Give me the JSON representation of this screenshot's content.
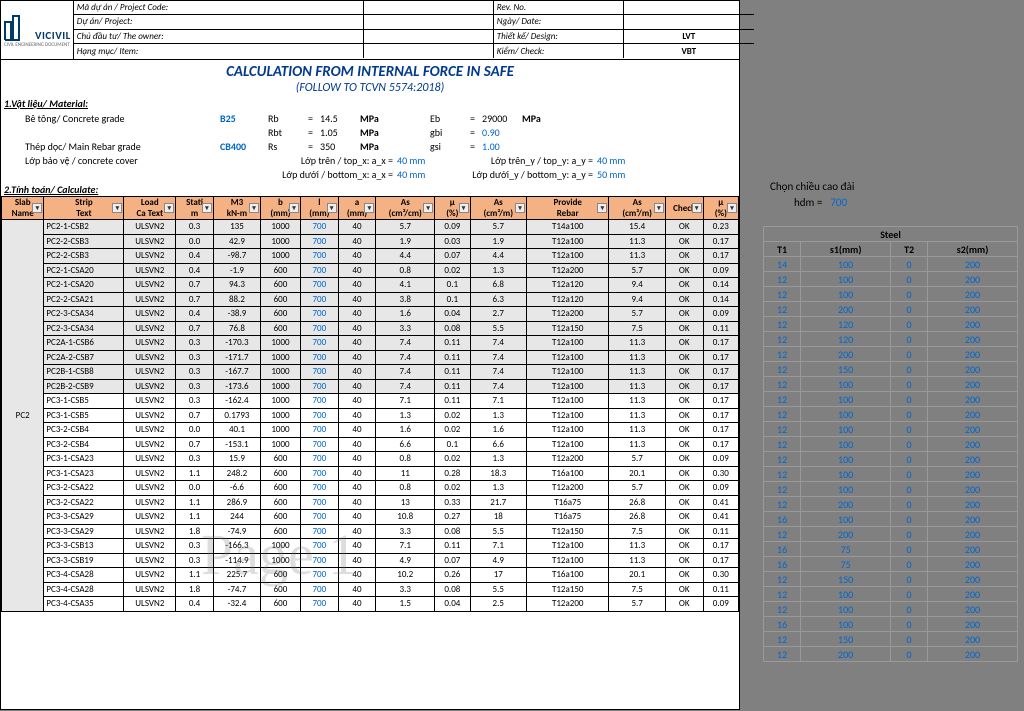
{
  "header": {
    "project_code_lbl": "Mã dự án / Project Code:",
    "project_lbl": "Dự án/ Project:",
    "owner_lbl": "Chủ đầu tư/ The owner:",
    "item_lbl": "Hạng mục/ Item:",
    "rev_lbl": "Rev. No.",
    "date_lbl": "Ngày/ Date:",
    "design_lbl": "Thiết kế/ Design:",
    "design_val": "LVT",
    "check_lbl": "Kiểm/ Check:",
    "check_val": "VBT"
  },
  "logo_text": "VICIVIL",
  "logo_sub": "CIVIL ENGINEERING DOCUMENT",
  "title1": "CALCULATION FROM INTERNAL FORCE IN SAFE",
  "title2": "(FOLLOW TO TCVN 5574:2018)",
  "sec1": "1.Vật liệu/ Material:",
  "sec2": "2.Tính toán/ Calculate:",
  "material": {
    "concrete_lbl": "Bê tông/ Concrete grade",
    "concrete_val": "B25",
    "Rb_sym": "Rb",
    "Rb_eq": "=",
    "Rb_num": "14.5",
    "Rb_unit": "MPa",
    "Rbt_sym": "Rbt",
    "Rbt_eq": "=",
    "Rbt_num": "1.05",
    "Rbt_unit": "MPa",
    "Eb_sym": "Eb",
    "Eb_eq": "=",
    "Eb_num": "29000",
    "Eb_unit": "MPa",
    "gbi_sym": "gbi",
    "gbi_eq": "=",
    "gbi_num": "0.90",
    "rebar_lbl": "Thép dọc/ Main Rebar grade",
    "rebar_val": "CB400",
    "Rs_sym": "Rs",
    "Rs_eq": "=",
    "Rs_num": "350",
    "Rs_unit": "MPa",
    "gsi_sym": "gsi",
    "gsi_eq": "=",
    "gsi_num": "1.00",
    "cover_lbl": "Lớp bảo vệ / concrete cover",
    "topx_lbl": "Lớp trên / top_x:  a_x =",
    "topx_val": "40 mm",
    "botx_lbl": "Lớp dưới / bottom_x:  a_x =",
    "botx_val": "40 mm",
    "topy_lbl": "Lớp trên_y / top_y:  a_y =",
    "topy_val": "40 mm",
    "boty_lbl": "Lớp dưới_y / bottom_y:  a_y =",
    "boty_val": "50 mm"
  },
  "side": {
    "label": "Chọn chiều cao đài",
    "hdm_lbl": "hdm =",
    "hdm_val": "700"
  },
  "cols": [
    "Slab Name",
    "Strip Text",
    "Load Ca Text",
    "Stati m",
    "M3 kN-m",
    "b (mm)",
    "l (mm)",
    "a (mm)",
    "As (cm²/cm)",
    "μ (%)",
    "As (cm²/m)",
    "Provide Rebar",
    "As (cm²/m)",
    "Check",
    "μ (%)"
  ],
  "steel_hdr": "Steel",
  "steel_cols": [
    "T1",
    "s1(mm)",
    "T2",
    "s2(mm)"
  ],
  "rows": [
    {
      "slab": "PC2",
      "strip": "PC2-1-CSB2",
      "lc": "ULSVN2",
      "st": "0.3",
      "m3": "135",
      "b": "1000",
      "l": "700",
      "a": "40",
      "asc": "5.7",
      "mu": "0.09",
      "asm": "5.7",
      "rebar": "T14a100",
      "asp": "15.4",
      "chk": "OK",
      "mu2": "0.23",
      "t1": "14",
      "s1": "100",
      "t2": "0",
      "s2": "200",
      "band": 1
    },
    {
      "slab": "",
      "strip": "PC2-2-CSB3",
      "lc": "ULSVN2",
      "st": "0.0",
      "m3": "42.9",
      "b": "1000",
      "l": "700",
      "a": "40",
      "asc": "1.9",
      "mu": "0.03",
      "asm": "1.9",
      "rebar": "T12a100",
      "asp": "11.3",
      "chk": "OK",
      "mu2": "0.17",
      "t1": "12",
      "s1": "100",
      "t2": "0",
      "s2": "200",
      "band": 1
    },
    {
      "slab": "",
      "strip": "PC2-2-CSB3",
      "lc": "ULSVN2",
      "st": "0.4",
      "m3": "-98.7",
      "b": "1000",
      "l": "700",
      "a": "40",
      "asc": "4.4",
      "mu": "0.07",
      "asm": "4.4",
      "rebar": "T12a100",
      "asp": "11.3",
      "chk": "OK",
      "mu2": "0.17",
      "t1": "12",
      "s1": "100",
      "t2": "0",
      "s2": "200",
      "band": 1
    },
    {
      "slab": "",
      "strip": "PC2-1-CSA20",
      "lc": "ULSVN2",
      "st": "0.4",
      "m3": "-1.9",
      "b": "600",
      "l": "700",
      "a": "40",
      "asc": "0.8",
      "mu": "0.02",
      "asm": "1.3",
      "rebar": "T12a200",
      "asp": "5.7",
      "chk": "OK",
      "mu2": "0.09",
      "t1": "12",
      "s1": "200",
      "t2": "0",
      "s2": "200",
      "band": 1
    },
    {
      "slab": "",
      "strip": "PC2-1-CSA20",
      "lc": "ULSVN2",
      "st": "0.7",
      "m3": "94.3",
      "b": "600",
      "l": "700",
      "a": "40",
      "asc": "4.1",
      "mu": "0.1",
      "asm": "6.8",
      "rebar": "T12a120",
      "asp": "9.4",
      "chk": "OK",
      "mu2": "0.14",
      "t1": "12",
      "s1": "120",
      "t2": "0",
      "s2": "200",
      "band": 1
    },
    {
      "slab": "",
      "strip": "PC2-2-CSA21",
      "lc": "ULSVN2",
      "st": "0.7",
      "m3": "88.2",
      "b": "600",
      "l": "700",
      "a": "40",
      "asc": "3.8",
      "mu": "0.1",
      "asm": "6.3",
      "rebar": "T12a120",
      "asp": "9.4",
      "chk": "OK",
      "mu2": "0.14",
      "t1": "12",
      "s1": "120",
      "t2": "0",
      "s2": "200",
      "band": 1
    },
    {
      "slab": "",
      "strip": "PC2-3-CSA34",
      "lc": "ULSVN2",
      "st": "0.4",
      "m3": "-38.9",
      "b": "600",
      "l": "700",
      "a": "40",
      "asc": "1.6",
      "mu": "0.04",
      "asm": "2.7",
      "rebar": "T12a200",
      "asp": "5.7",
      "chk": "OK",
      "mu2": "0.09",
      "t1": "12",
      "s1": "200",
      "t2": "0",
      "s2": "200",
      "band": 1
    },
    {
      "slab": "",
      "strip": "PC2-3-CSA34",
      "lc": "ULSVN2",
      "st": "0.7",
      "m3": "76.8",
      "b": "600",
      "l": "700",
      "a": "40",
      "asc": "3.3",
      "mu": "0.08",
      "asm": "5.5",
      "rebar": "T12a150",
      "asp": "7.5",
      "chk": "OK",
      "mu2": "0.11",
      "t1": "12",
      "s1": "150",
      "t2": "0",
      "s2": "200",
      "band": 1
    },
    {
      "slab": "",
      "strip": "PC2A-1-CSB6",
      "lc": "ULSVN2",
      "st": "0.3",
      "m3": "-170.3",
      "b": "1000",
      "l": "700",
      "a": "40",
      "asc": "7.4",
      "mu": "0.11",
      "asm": "7.4",
      "rebar": "T12a100",
      "asp": "11.3",
      "chk": "OK",
      "mu2": "0.17",
      "t1": "12",
      "s1": "100",
      "t2": "0",
      "s2": "200",
      "band": 1
    },
    {
      "slab": "",
      "strip": "PC2A-2-CSB7",
      "lc": "ULSVN2",
      "st": "0.3",
      "m3": "-171.7",
      "b": "1000",
      "l": "700",
      "a": "40",
      "asc": "7.4",
      "mu": "0.11",
      "asm": "7.4",
      "rebar": "T12a100",
      "asp": "11.3",
      "chk": "OK",
      "mu2": "0.17",
      "t1": "12",
      "s1": "100",
      "t2": "0",
      "s2": "200",
      "band": 1
    },
    {
      "slab": "",
      "strip": "PC2B-1-CSB8",
      "lc": "ULSVN2",
      "st": "0.3",
      "m3": "-167.7",
      "b": "1000",
      "l": "700",
      "a": "40",
      "asc": "7.4",
      "mu": "0.11",
      "asm": "7.4",
      "rebar": "T12a100",
      "asp": "11.3",
      "chk": "OK",
      "mu2": "0.17",
      "t1": "12",
      "s1": "100",
      "t2": "0",
      "s2": "200",
      "band": 1
    },
    {
      "slab": "",
      "strip": "PC2B-2-CSB9",
      "lc": "ULSVN2",
      "st": "0.3",
      "m3": "-173.6",
      "b": "1000",
      "l": "700",
      "a": "40",
      "asc": "7.4",
      "mu": "0.11",
      "asm": "7.4",
      "rebar": "T12a100",
      "asp": "11.3",
      "chk": "OK",
      "mu2": "0.17",
      "t1": "12",
      "s1": "100",
      "t2": "0",
      "s2": "200",
      "band": 1
    },
    {
      "slab": "",
      "strip": "PC3-1-CSB5",
      "lc": "ULSVN2",
      "st": "0.3",
      "m3": "-162.4",
      "b": "1000",
      "l": "700",
      "a": "40",
      "asc": "7.1",
      "mu": "0.11",
      "asm": "7.1",
      "rebar": "T12a100",
      "asp": "11.3",
      "chk": "OK",
      "mu2": "0.17",
      "t1": "12",
      "s1": "100",
      "t2": "0",
      "s2": "200",
      "band": 0
    },
    {
      "slab": "",
      "strip": "PC3-1-CSB5",
      "lc": "ULSVN2",
      "st": "0.7",
      "m3": "0.1793",
      "b": "1000",
      "l": "700",
      "a": "40",
      "asc": "1.3",
      "mu": "0.02",
      "asm": "1.3",
      "rebar": "T12a100",
      "asp": "11.3",
      "chk": "OK",
      "mu2": "0.17",
      "t1": "12",
      "s1": "100",
      "t2": "0",
      "s2": "200",
      "band": 0
    },
    {
      "slab": "",
      "strip": "PC3-2-CSB4",
      "lc": "ULSVN2",
      "st": "0.0",
      "m3": "40.1",
      "b": "1000",
      "l": "700",
      "a": "40",
      "asc": "1.6",
      "mu": "0.02",
      "asm": "1.6",
      "rebar": "T12a100",
      "asp": "11.3",
      "chk": "OK",
      "mu2": "0.17",
      "t1": "12",
      "s1": "100",
      "t2": "0",
      "s2": "200",
      "band": 0
    },
    {
      "slab": "",
      "strip": "PC3-2-CSB4",
      "lc": "ULSVN2",
      "st": "0.7",
      "m3": "-153.1",
      "b": "1000",
      "l": "700",
      "a": "40",
      "asc": "6.6",
      "mu": "0.1",
      "asm": "6.6",
      "rebar": "T12a100",
      "asp": "11.3",
      "chk": "OK",
      "mu2": "0.17",
      "t1": "12",
      "s1": "100",
      "t2": "0",
      "s2": "200",
      "band": 0
    },
    {
      "slab": "",
      "strip": "PC3-1-CSA23",
      "lc": "ULSVN2",
      "st": "0.3",
      "m3": "15.9",
      "b": "600",
      "l": "700",
      "a": "40",
      "asc": "0.8",
      "mu": "0.02",
      "asm": "1.3",
      "rebar": "T12a200",
      "asp": "5.7",
      "chk": "OK",
      "mu2": "0.09",
      "t1": "12",
      "s1": "200",
      "t2": "0",
      "s2": "200",
      "band": 0
    },
    {
      "slab": "",
      "strip": "PC3-1-CSA23",
      "lc": "ULSVN2",
      "st": "1.1",
      "m3": "248.2",
      "b": "600",
      "l": "700",
      "a": "40",
      "asc": "11",
      "mu": "0.28",
      "asm": "18.3",
      "rebar": "T16a100",
      "asp": "20.1",
      "chk": "OK",
      "mu2": "0.30",
      "t1": "16",
      "s1": "100",
      "t2": "0",
      "s2": "200",
      "band": 0
    },
    {
      "slab": "",
      "strip": "PC3-2-CSA22",
      "lc": "ULSVN2",
      "st": "0.0",
      "m3": "-6.6",
      "b": "600",
      "l": "700",
      "a": "40",
      "asc": "0.8",
      "mu": "0.02",
      "asm": "1.3",
      "rebar": "T12a200",
      "asp": "5.7",
      "chk": "OK",
      "mu2": "0.09",
      "t1": "12",
      "s1": "200",
      "t2": "0",
      "s2": "200",
      "band": 0
    },
    {
      "slab": "",
      "strip": "PC3-2-CSA22",
      "lc": "ULSVN2",
      "st": "1.1",
      "m3": "286.9",
      "b": "600",
      "l": "700",
      "a": "40",
      "asc": "13",
      "mu": "0.33",
      "asm": "21.7",
      "rebar": "T16a75",
      "asp": "26.8",
      "chk": "OK",
      "mu2": "0.41",
      "t1": "16",
      "s1": "75",
      "t2": "0",
      "s2": "200",
      "band": 0
    },
    {
      "slab": "",
      "strip": "PC3-3-CSA29",
      "lc": "ULSVN2",
      "st": "1.1",
      "m3": "244",
      "b": "600",
      "l": "700",
      "a": "40",
      "asc": "10.8",
      "mu": "0.27",
      "asm": "18",
      "rebar": "T16a75",
      "asp": "26.8",
      "chk": "OK",
      "mu2": "0.41",
      "t1": "16",
      "s1": "75",
      "t2": "0",
      "s2": "200",
      "band": 0
    },
    {
      "slab": "",
      "strip": "PC3-3-CSA29",
      "lc": "ULSVN2",
      "st": "1.8",
      "m3": "-74.9",
      "b": "600",
      "l": "700",
      "a": "40",
      "asc": "3.3",
      "mu": "0.08",
      "asm": "5.5",
      "rebar": "T12a150",
      "asp": "7.5",
      "chk": "OK",
      "mu2": "0.11",
      "t1": "12",
      "s1": "150",
      "t2": "0",
      "s2": "200",
      "band": 0
    },
    {
      "slab": "",
      "strip": "PC3-3-CSB13",
      "lc": "ULSVN2",
      "st": "0.3",
      "m3": "-166.3",
      "b": "1000",
      "l": "700",
      "a": "40",
      "asc": "7.1",
      "mu": "0.11",
      "asm": "7.1",
      "rebar": "T12a100",
      "asp": "11.3",
      "chk": "OK",
      "mu2": "0.17",
      "t1": "12",
      "s1": "100",
      "t2": "0",
      "s2": "200",
      "band": 0
    },
    {
      "slab": "",
      "strip": "PC3-3-CSB19",
      "lc": "ULSVN2",
      "st": "0.3",
      "m3": "-114.9",
      "b": "1000",
      "l": "700",
      "a": "40",
      "asc": "4.9",
      "mu": "0.07",
      "asm": "4.9",
      "rebar": "T12a100",
      "asp": "11.3",
      "chk": "OK",
      "mu2": "0.17",
      "t1": "12",
      "s1": "100",
      "t2": "0",
      "s2": "200",
      "band": 0
    },
    {
      "slab": "",
      "strip": "PC3-4-CSA28",
      "lc": "ULSVN2",
      "st": "1.1",
      "m3": "225.7",
      "b": "600",
      "l": "700",
      "a": "40",
      "asc": "10.2",
      "mu": "0.26",
      "asm": "17",
      "rebar": "T16a100",
      "asp": "20.1",
      "chk": "OK",
      "mu2": "0.30",
      "t1": "16",
      "s1": "100",
      "t2": "0",
      "s2": "200",
      "band": 0
    },
    {
      "slab": "",
      "strip": "PC3-4-CSA28",
      "lc": "ULSVN2",
      "st": "1.8",
      "m3": "-74.7",
      "b": "600",
      "l": "700",
      "a": "40",
      "asc": "3.3",
      "mu": "0.08",
      "asm": "5.5",
      "rebar": "T12a150",
      "asp": "7.5",
      "chk": "OK",
      "mu2": "0.11",
      "t1": "12",
      "s1": "150",
      "t2": "0",
      "s2": "200",
      "band": 0
    },
    {
      "slab": "",
      "strip": "PC3-4-CSA35",
      "lc": "ULSVN2",
      "st": "0.4",
      "m3": "-32.4",
      "b": "600",
      "l": "700",
      "a": "40",
      "asc": "1.5",
      "mu": "0.04",
      "asm": "2.5",
      "rebar": "T12a200",
      "asp": "5.7",
      "chk": "OK",
      "mu2": "0.09",
      "t1": "12",
      "s1": "200",
      "t2": "0",
      "s2": "200",
      "band": 0
    }
  ],
  "watermark": "Page 1"
}
